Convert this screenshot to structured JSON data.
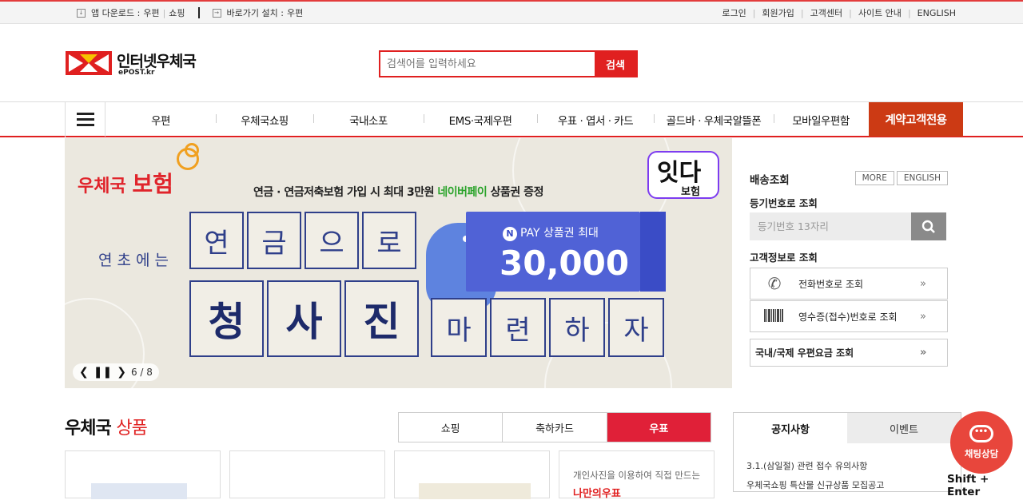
{
  "topbar": {
    "app_download_label": "앱 다운로드 :",
    "app_links": [
      "우편",
      "쇼핑"
    ],
    "shortcut_label": "바로가기 설치 :",
    "shortcut_link": "우편",
    "right_links": [
      "로그인",
      "회원가입",
      "고객센터",
      "사이트 안내",
      "ENGLISH"
    ]
  },
  "header": {
    "logo_text": "인터넷우체국",
    "logo_sub": "ePOST.kr",
    "search_placeholder": "검색어를 입력하세요",
    "search_button": "검색"
  },
  "gnb": {
    "items": [
      "우편",
      "우체국쇼핑",
      "국내소포",
      "EMS·국제우편",
      "우표 · 엽서 · 카드",
      "골드바 · 우체국알뜰폰",
      "모바일우편함"
    ],
    "customer_button": "계약고객전용"
  },
  "banner": {
    "brand": "우체국",
    "brand_big": "보험",
    "headline_pre": "연금 · 연금저축보험 가입 시 최대 3만원",
    "headline_hl": "네이버페이",
    "headline_post": "상품권 증정",
    "itda_title": "잇다",
    "itda_sub": "보험",
    "left_phrase": "연초에는",
    "grid_row1": [
      "연",
      "금",
      "으",
      "로"
    ],
    "grid_row2": [
      "청",
      "사",
      "진"
    ],
    "grid_row3": [
      "마",
      "련",
      "하",
      "자"
    ],
    "ticket_label": "PAY 상품권 최대",
    "ticket_n": "N",
    "ticket_amount": "30,000",
    "pager_text": "6 / 8"
  },
  "tracking": {
    "title": "배송조회",
    "more_button": "MORE",
    "english_button": "ENGLISH",
    "reg_label": "등기번호로 조회",
    "reg_placeholder": "등기번호 13자리",
    "customer_label": "고객정보로 조회",
    "phone_lookup": "전화번호로 조회",
    "receipt_lookup": "영수증(접수)번호로 조회",
    "rate_lookup": "국내/국제 우편요금 조회"
  },
  "products": {
    "title": "우체국",
    "title_hl": "상품",
    "tabs": [
      "쇼핑",
      "축하카드",
      "우표"
    ],
    "active_tab": "우표",
    "card4_text": "개인사진을 이용하여 직접 만드는",
    "card4_title": "나만의우표"
  },
  "notices": {
    "tabs": [
      "공지사항",
      "이벤트"
    ],
    "items": [
      "3.1.(삼일절) 관련 접수 유의사항",
      "우체국쇼핑 특산물 신규상품 모집공고"
    ]
  },
  "chat": {
    "label": "채팅상담",
    "shortcut": "Shift + Enter"
  },
  "colors": {
    "accent": "#e02020",
    "customer_btn": "#cc3a14",
    "active_tab": "#e02038",
    "banner_navy": "#2f3f8a",
    "ticket_blue": "#5062d6"
  }
}
